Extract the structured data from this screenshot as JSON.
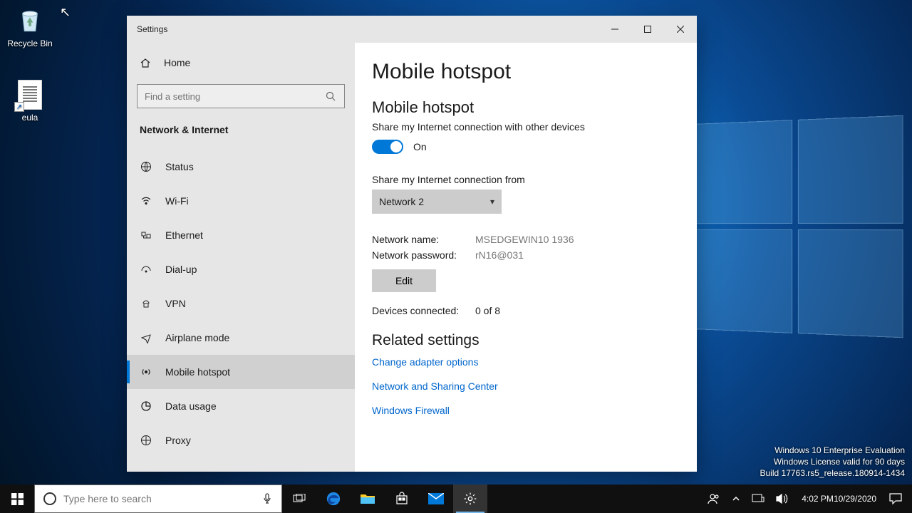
{
  "desktop": {
    "icons": {
      "recycle": "Recycle Bin",
      "eula": "eula"
    },
    "watermark": {
      "l1": "Windows 10 Enterprise Evaluation",
      "l2": "Windows License valid for 90 days",
      "l3": "Build 17763.rs5_release.180914-1434"
    }
  },
  "window": {
    "title": "Settings",
    "home": "Home",
    "search_placeholder": "Find a setting",
    "category": "Network & Internet",
    "nav": {
      "status": "Status",
      "wifi": "Wi-Fi",
      "ethernet": "Ethernet",
      "dialup": "Dial-up",
      "vpn": "VPN",
      "airplane": "Airplane mode",
      "hotspot": "Mobile hotspot",
      "datausage": "Data usage",
      "proxy": "Proxy"
    },
    "main": {
      "page_title": "Mobile hotspot",
      "section1_title": "Mobile hotspot",
      "section1_desc": "Share my Internet connection with other devices",
      "toggle_state": "On",
      "share_from_label": "Share my Internet connection from",
      "share_from_value": "Network 2",
      "netname_label": "Network name:",
      "netname_value": "MSEDGEWIN10 1936",
      "netpass_label": "Network password:",
      "netpass_value": "rN16@031",
      "edit_label": "Edit",
      "devices_label": "Devices connected:",
      "devices_value": "0 of 8",
      "related_title": "Related settings",
      "link1": "Change adapter options",
      "link2": "Network and Sharing Center",
      "link3": "Windows Firewall"
    }
  },
  "taskbar": {
    "search_placeholder": "Type here to search",
    "clock": {
      "time": "4:02 PM",
      "date": "10/29/2020"
    }
  }
}
